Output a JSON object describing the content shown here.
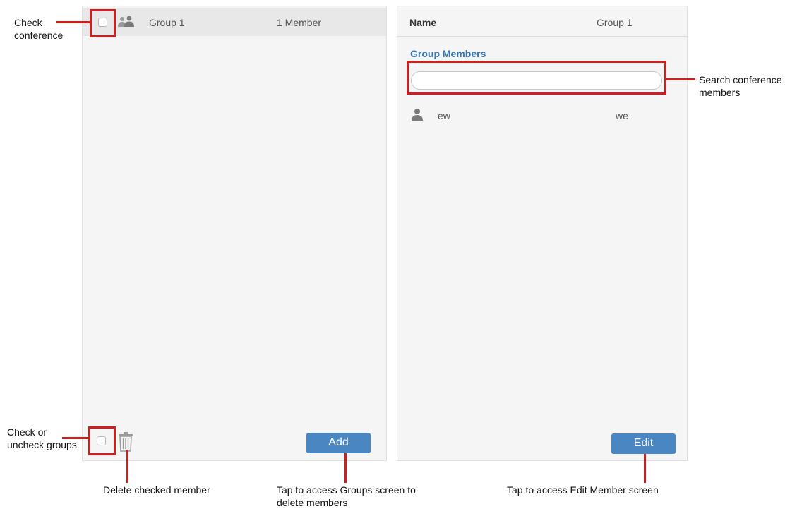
{
  "group_list": {
    "rows": [
      {
        "name": "Group 1",
        "count": "1 Member"
      }
    ],
    "add_label": "Add"
  },
  "detail": {
    "name_label": "Name",
    "name_value": "Group 1",
    "members_title": "Group Members",
    "search_placeholder": "",
    "members": [
      {
        "name": "ew",
        "value": "we"
      }
    ],
    "edit_label": "Edit"
  },
  "annotations": {
    "check_conference": [
      "Check",
      "conference"
    ],
    "check_uncheck_groups": [
      "Check or",
      "uncheck groups"
    ],
    "delete_checked": "Delete checked member",
    "tap_groups": [
      "Tap to access Groups screen to",
      "delete members"
    ],
    "tap_edit": "Tap to access Edit Member screen",
    "search_members": [
      "Search conference",
      "members"
    ]
  },
  "colors": {
    "annotation_red": "#cc1f1f",
    "accent_blue": "#4a87c2",
    "title_blue": "#3a78b5"
  }
}
